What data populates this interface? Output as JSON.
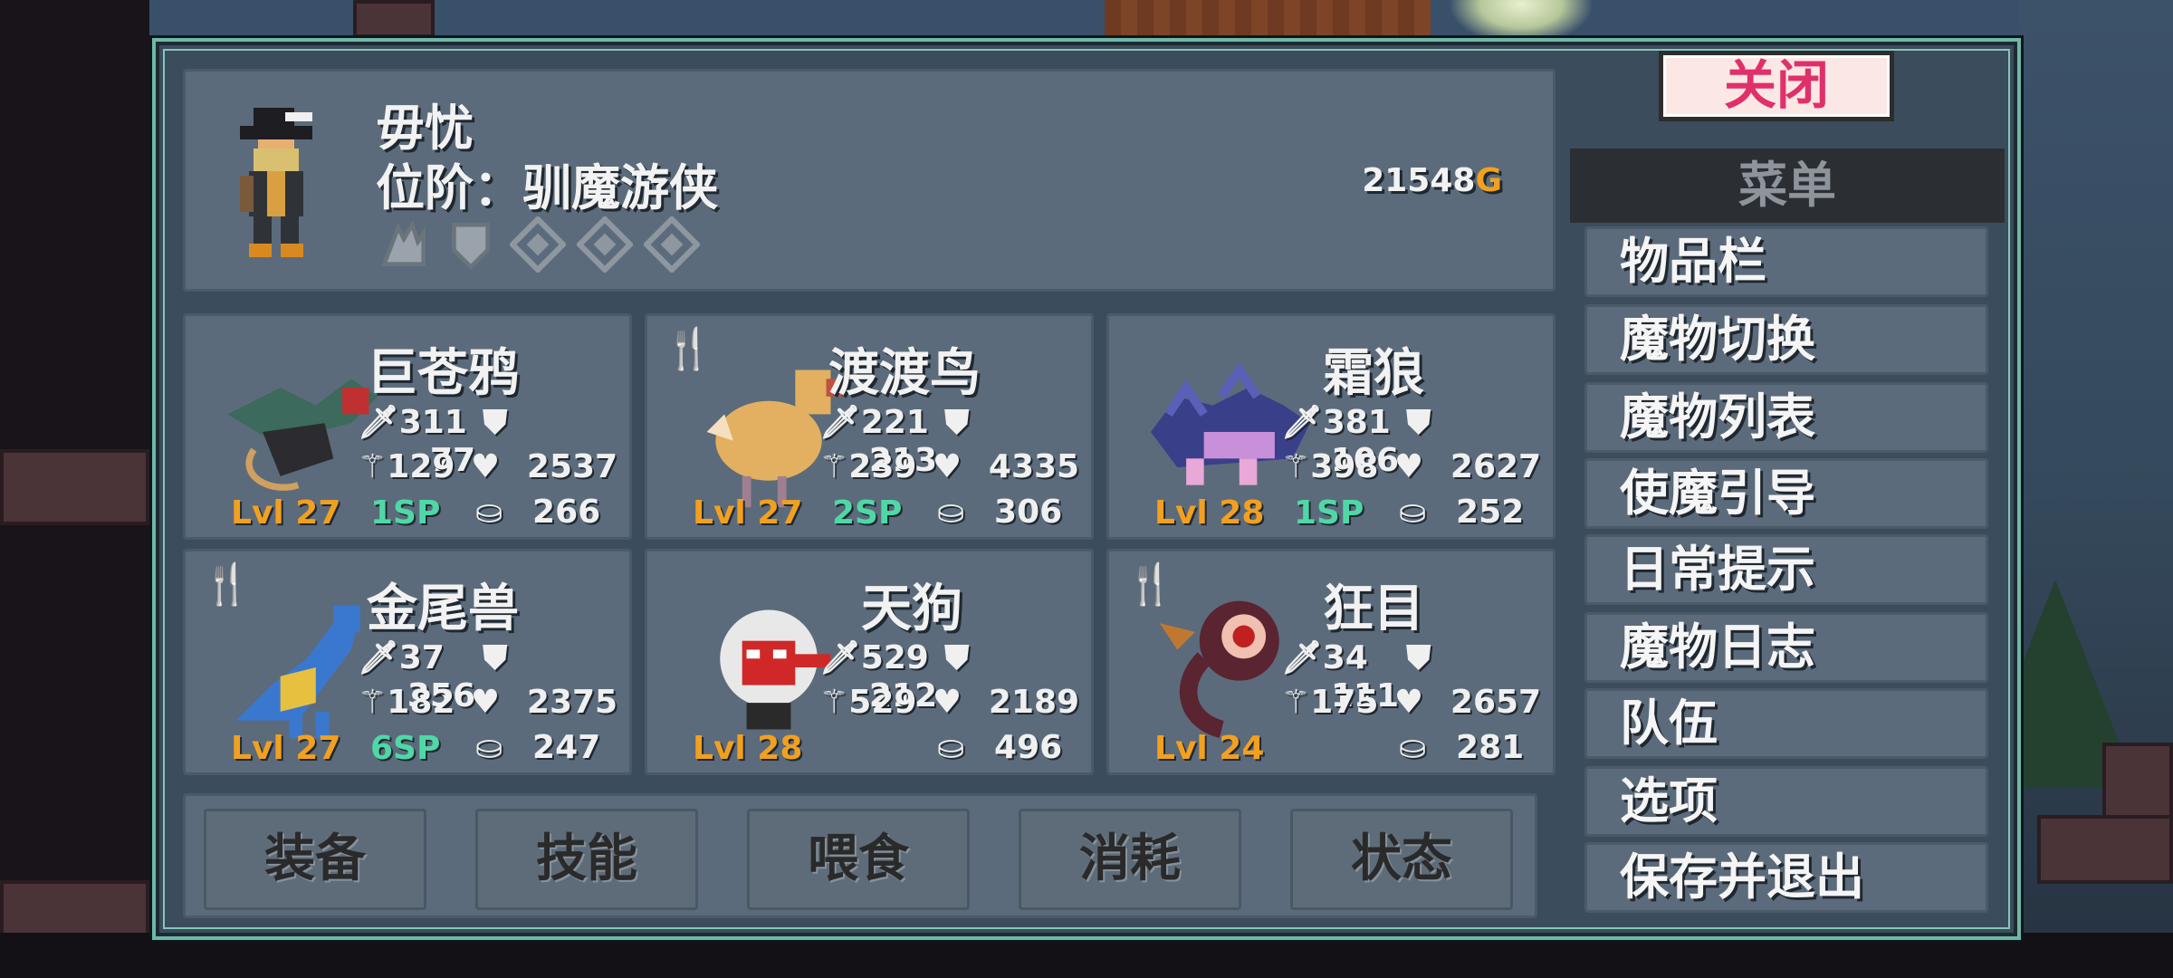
{
  "player": {
    "name": "毋忧",
    "rank": "位阶：驯魔游侠",
    "gold": "21548",
    "gold_unit": "G",
    "keys": [
      "claw-key-icon",
      "shield-key-icon",
      "diamond-key-icon",
      "diamond-key-icon",
      "diamond-key-icon"
    ]
  },
  "monsters": [
    {
      "name": "巨苍鸦",
      "attack": "311",
      "defense": "77",
      "magic": "129",
      "health": "2537",
      "level": "Lvl 27",
      "sp": "1SP",
      "mana": "266",
      "food": false
    },
    {
      "name": "渡渡鸟",
      "attack": "221",
      "defense": "213",
      "magic": "239",
      "health": "4335",
      "level": "Lvl 27",
      "sp": "2SP",
      "mana": "306",
      "food": true
    },
    {
      "name": "霜狼",
      "attack": "381",
      "defense": "106",
      "magic": "398",
      "health": "2627",
      "level": "Lvl 28",
      "sp": "1SP",
      "mana": "252",
      "food": false
    },
    {
      "name": "金尾兽",
      "attack": "37",
      "defense": "356",
      "magic": "182",
      "health": "2375",
      "level": "Lvl 27",
      "sp": "6SP",
      "mana": "247",
      "food": true
    },
    {
      "name": "天狗",
      "attack": "529",
      "defense": "212",
      "magic": "529",
      "health": "2189",
      "level": "Lvl 28",
      "sp": "",
      "mana": "496",
      "food": false
    },
    {
      "name": "狂目",
      "attack": "34",
      "defense": "111",
      "magic": "175",
      "health": "2657",
      "level": "Lvl 24",
      "sp": "",
      "mana": "281",
      "food": true
    }
  ],
  "actions": [
    "装备",
    "技能",
    "喂食",
    "消耗",
    "状态"
  ],
  "menu": {
    "close": "关闭",
    "title": "菜单",
    "items": [
      "物品栏",
      "魔物切换",
      "魔物列表",
      "使魔引导",
      "日常提示",
      "魔物日志",
      "队伍",
      "选项",
      "保存并退出"
    ]
  },
  "colors": {
    "accent": "#6fb8a8",
    "level": "#f2a020",
    "sp": "#4fd8a6",
    "close_text": "#e0306a"
  }
}
